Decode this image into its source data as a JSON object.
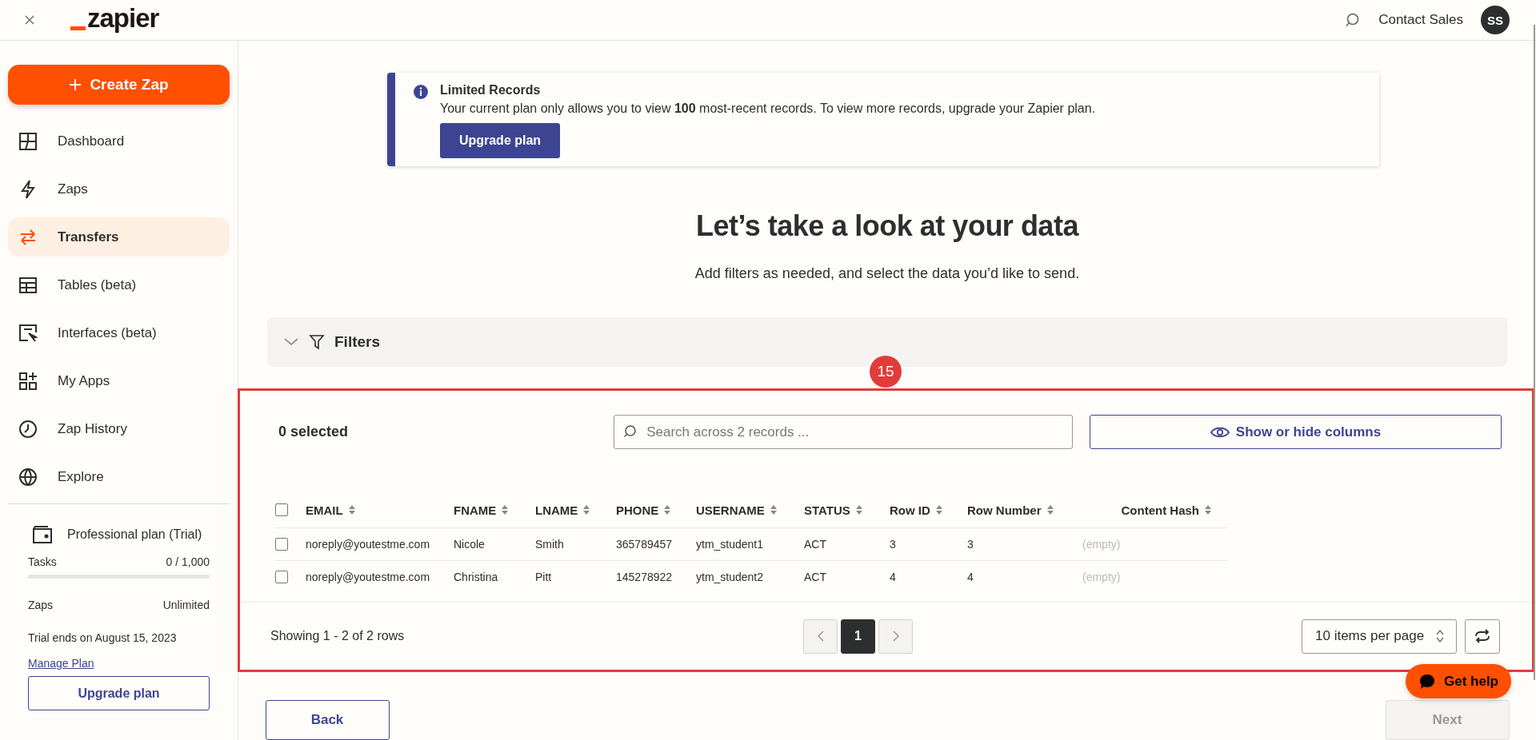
{
  "top_bar": {
    "logo": "zapier",
    "contact": "Contact Sales",
    "avatar": "SS"
  },
  "sidebar": {
    "create_button": "Create Zap",
    "items": [
      {
        "label": "Dashboard",
        "kind": "dashboard",
        "selected": false
      },
      {
        "label": "Zaps",
        "kind": "bolt",
        "selected": false
      },
      {
        "label": "Transfers",
        "kind": "transfer",
        "selected": true
      },
      {
        "label": "Tables (beta)",
        "kind": "table",
        "selected": false
      },
      {
        "label": "Interfaces (beta)",
        "kind": "interface",
        "selected": false
      },
      {
        "label": "My Apps",
        "kind": "apps",
        "selected": false
      },
      {
        "label": "Zap History",
        "kind": "clock",
        "selected": false
      },
      {
        "label": "Explore",
        "kind": "globe",
        "selected": false
      }
    ],
    "plan": {
      "name": "Professional plan (Trial)",
      "tasks_label": "Tasks",
      "tasks_value": "0 / 1,000",
      "level": 0,
      "zaps_label": "Zaps",
      "zaps_value": "Unlimited",
      "trial": "Trial ends on August 15, 2023",
      "manage_link": "Manage Plan",
      "upgrade_button": "Upgrade plan"
    }
  },
  "banner": {
    "title": "Limited Records",
    "text": "Your current plan only allows you to view **100** most-recent records. To view more records, upgrade your Zapier plan.",
    "button": "Upgrade plan"
  },
  "heading": "Let’s take a look at your data",
  "subtitle": "Add filters as needed, and select the data you’d like to send.",
  "filters": {
    "label": "Filters",
    "expanded": false
  },
  "annotation": {
    "label": "15"
  },
  "records": {
    "selected_count": "0 selected",
    "all_selected": false,
    "search_placeholder": "Search across 2 records ...",
    "columns_button": "Show or hide columns",
    "columns": [
      "EMAIL",
      "FNAME",
      "LNAME",
      "PHONE",
      "USERNAME",
      "STATUS",
      "Row ID",
      "Row Number",
      "Content Hash"
    ],
    "rows": [
      {
        "selected": false,
        "cells": [
          "noreply@youtestme.com",
          "Nicole",
          "Smith",
          "365789457",
          "ytm_student1",
          "ACT",
          "3",
          "3",
          "(empty)"
        ]
      },
      {
        "selected": false,
        "cells": [
          "noreply@youtestme.com",
          "Christina",
          "Pitt",
          "145278922",
          "ytm_student2",
          "ACT",
          "4",
          "4",
          "(empty)"
        ]
      }
    ],
    "showing": "Showing 1 - 2 of 2 rows",
    "pages": [
      {
        "label": "1",
        "selected": true
      }
    ],
    "per_page": "10 items per page"
  },
  "actions": {
    "back": "Back",
    "next": "Next",
    "next_disabled": true
  },
  "help_button": "Get help"
}
